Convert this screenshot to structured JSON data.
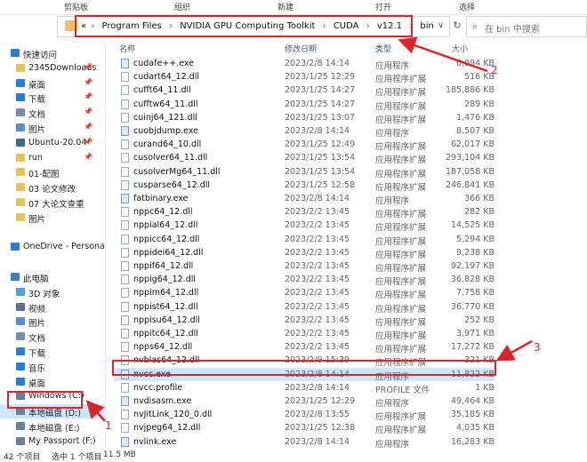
{
  "ribbon": {
    "clipboard": "剪贴板",
    "organize": "组织",
    "new": "新建",
    "open": "打开",
    "select": "选择"
  },
  "address": {
    "prefix": "«",
    "segments": [
      "Program Files",
      "NVIDIA GPU Computing Toolkit",
      "CUDA",
      "v12.1",
      "bin"
    ],
    "separator": "›",
    "dropdown": "∨"
  },
  "search": {
    "placeholder": "在 bin 中搜索"
  },
  "columns": {
    "name": "名称",
    "date": "修改日期",
    "type": "类型",
    "size": "大小"
  },
  "sidebar": [
    {
      "label": "快速访问",
      "icon": "star-icon",
      "color": "#2b7cd3",
      "indent": 0,
      "pin": ""
    },
    {
      "label": "2345Downloads",
      "icon": "folder-icon",
      "color": "#e8c25a",
      "indent": 1,
      "pin": "📌"
    },
    {
      "label": "桌面",
      "icon": "desktop-icon",
      "color": "#2b7cd3",
      "indent": 1,
      "pin": "📌"
    },
    {
      "label": "下载",
      "icon": "download-icon",
      "color": "#2b7cd3",
      "indent": 1,
      "pin": "📌"
    },
    {
      "label": "文档",
      "icon": "document-icon",
      "color": "#7a8ea6",
      "indent": 1,
      "pin": "📌"
    },
    {
      "label": "图片",
      "icon": "pictures-icon",
      "color": "#5b8fc7",
      "indent": 1,
      "pin": "📌"
    },
    {
      "label": "Ubuntu-20.04",
      "icon": "linux-icon",
      "color": "#3c6e8c",
      "indent": 1,
      "pin": "📌"
    },
    {
      "label": "run",
      "icon": "folder-icon",
      "color": "#e8c25a",
      "indent": 1,
      "pin": "📌"
    },
    {
      "label": "01-配图",
      "icon": "folder-icon",
      "color": "#e8c25a",
      "indent": 1,
      "pin": ""
    },
    {
      "label": "03 论文修改",
      "icon": "folder-icon",
      "color": "#e8c25a",
      "indent": 1,
      "pin": ""
    },
    {
      "label": "07 大论文查重",
      "icon": "folder-icon",
      "color": "#e8c25a",
      "indent": 1,
      "pin": ""
    },
    {
      "label": "图片",
      "icon": "folder-icon",
      "color": "#e8c25a",
      "indent": 1,
      "pin": ""
    },
    {
      "label": "",
      "icon": "",
      "color": "",
      "indent": 0,
      "pin": ""
    },
    {
      "label": "OneDrive - Persona",
      "icon": "cloud-icon",
      "color": "#2b7cd3",
      "indent": 0,
      "pin": ""
    },
    {
      "label": "",
      "icon": "",
      "color": "",
      "indent": 0,
      "pin": ""
    },
    {
      "label": "此电脑",
      "icon": "computer-icon",
      "color": "#3c7fc7",
      "indent": 0,
      "pin": ""
    },
    {
      "label": "3D 对象",
      "icon": "cube-icon",
      "color": "#4fa3d9",
      "indent": 1,
      "pin": ""
    },
    {
      "label": "视频",
      "icon": "video-icon",
      "color": "#5b6f8a",
      "indent": 1,
      "pin": ""
    },
    {
      "label": "图片",
      "icon": "pictures-icon",
      "color": "#5b8fc7",
      "indent": 1,
      "pin": ""
    },
    {
      "label": "文档",
      "icon": "document-icon",
      "color": "#7a8ea6",
      "indent": 1,
      "pin": ""
    },
    {
      "label": "下载",
      "icon": "download-icon",
      "color": "#2b7cd3",
      "indent": 1,
      "pin": ""
    },
    {
      "label": "音乐",
      "icon": "music-icon",
      "color": "#2b7cd3",
      "indent": 1,
      "pin": ""
    },
    {
      "label": "桌面",
      "icon": "desktop-icon",
      "color": "#2b7cd3",
      "indent": 1,
      "pin": ""
    },
    {
      "label": "Windows (C:)",
      "icon": "drive-icon",
      "color": "#6a7f95",
      "indent": 1,
      "pin": ""
    },
    {
      "label": "本地磁盘 (D:)",
      "icon": "drive-icon",
      "color": "#6a7f95",
      "indent": 1,
      "pin": "",
      "selected": true
    },
    {
      "label": "本地磁盘 (E:)",
      "icon": "drive-icon",
      "color": "#6a7f95",
      "indent": 1,
      "pin": ""
    },
    {
      "label": "My Passport (F:)",
      "icon": "drive-icon",
      "color": "#6a7f95",
      "indent": 1,
      "pin": ""
    }
  ],
  "files": [
    {
      "name": "cudafe++.exe",
      "date": "2023/2/8 14:14",
      "type": "应用程序",
      "size": "6,094 KB",
      "kind": "exe"
    },
    {
      "name": "cudart64_12.dll",
      "date": "2023/1/25 12:29",
      "type": "应用程序扩展",
      "size": "516 KB",
      "kind": "dll"
    },
    {
      "name": "cufft64_11.dll",
      "date": "2023/1/25 14:27",
      "type": "应用程序扩展",
      "size": "185,886 KB",
      "kind": "dll"
    },
    {
      "name": "cufftw64_11.dll",
      "date": "2023/1/25 14:27",
      "type": "应用程序扩展",
      "size": "289 KB",
      "kind": "dll"
    },
    {
      "name": "cuinj64_121.dll",
      "date": "2023/1/25 13:07",
      "type": "应用程序扩展",
      "size": "1,476 KB",
      "kind": "dll"
    },
    {
      "name": "cuobjdump.exe",
      "date": "2023/2/8 14:14",
      "type": "应用程序",
      "size": "8,507 KB",
      "kind": "exe"
    },
    {
      "name": "curand64_10.dll",
      "date": "2023/1/25 12:49",
      "type": "应用程序扩展",
      "size": "62,017 KB",
      "kind": "dll"
    },
    {
      "name": "cusolver64_11.dll",
      "date": "2023/1/25 13:54",
      "type": "应用程序扩展",
      "size": "293,104 KB",
      "kind": "dll"
    },
    {
      "name": "cusolverMg64_11.dll",
      "date": "2023/1/25 13:54",
      "type": "应用程序扩展",
      "size": "187,058 KB",
      "kind": "dll"
    },
    {
      "name": "cusparse64_12.dll",
      "date": "2023/1/25 12:58",
      "type": "应用程序扩展",
      "size": "246,841 KB",
      "kind": "dll"
    },
    {
      "name": "fatbinary.exe",
      "date": "2023/2/8 14:14",
      "type": "应用程序",
      "size": "366 KB",
      "kind": "exe"
    },
    {
      "name": "nppc64_12.dll",
      "date": "2023/2/2 13:45",
      "type": "应用程序扩展",
      "size": "282 KB",
      "kind": "dll"
    },
    {
      "name": "nppial64_12.dll",
      "date": "2023/2/2 13:45",
      "type": "应用程序扩展",
      "size": "14,525 KB",
      "kind": "dll"
    },
    {
      "name": "nppicc64_12.dll",
      "date": "2023/2/2 13:45",
      "type": "应用程序扩展",
      "size": "5,294 KB",
      "kind": "dll"
    },
    {
      "name": "nppidei64_12.dll",
      "date": "2023/2/2 13:45",
      "type": "应用程序扩展",
      "size": "9,238 KB",
      "kind": "dll"
    },
    {
      "name": "nppif64_12.dll",
      "date": "2023/2/2 13:45",
      "type": "应用程序扩展",
      "size": "92,197 KB",
      "kind": "dll"
    },
    {
      "name": "nppig64_12.dll",
      "date": "2023/2/2 13:45",
      "type": "应用程序扩展",
      "size": "36,828 KB",
      "kind": "dll"
    },
    {
      "name": "nppim64_12.dll",
      "date": "2023/2/2 13:45",
      "type": "应用程序扩展",
      "size": "7,758 KB",
      "kind": "dll"
    },
    {
      "name": "nppist64_12.dll",
      "date": "2023/2/2 13:45",
      "type": "应用程序扩展",
      "size": "36,770 KB",
      "kind": "dll"
    },
    {
      "name": "nppisu64_12.dll",
      "date": "2023/2/2 13:45",
      "type": "应用程序扩展",
      "size": "252 KB",
      "kind": "dll"
    },
    {
      "name": "nppitc64_12.dll",
      "date": "2023/2/2 13:45",
      "type": "应用程序扩展",
      "size": "3,971 KB",
      "kind": "dll"
    },
    {
      "name": "npps64_12.dll",
      "date": "2023/2/2 13:45",
      "type": "应用程序扩展",
      "size": "17,272 KB",
      "kind": "dll"
    },
    {
      "name": "nvblas64_12.dll",
      "date": "2023/2/9 15:39",
      "type": "应用程序扩展",
      "size": "321 KB",
      "kind": "dll"
    },
    {
      "name": "nvcc.exe",
      "date": "2023/2/8 14:14",
      "type": "应用程序",
      "size": "11,822 KB",
      "kind": "exe",
      "selected": true
    },
    {
      "name": "nvcc.profile",
      "date": "2023/2/8 14:14",
      "type": "PROFILE 文件",
      "size": "1 KB",
      "kind": "file"
    },
    {
      "name": "nvdisasm.exe",
      "date": "2023/1/25 12:29",
      "type": "应用程序",
      "size": "49,464 KB",
      "kind": "exe"
    },
    {
      "name": "nvJitLink_120_0.dll",
      "date": "2023/2/8 13:55",
      "type": "应用程序扩展",
      "size": "35,185 KB",
      "kind": "dll"
    },
    {
      "name": "nvjpeg64_12.dll",
      "date": "2023/1/25 12:38",
      "type": "应用程序扩展",
      "size": "4,035 KB",
      "kind": "dll"
    },
    {
      "name": "nvlink.exe",
      "date": "2023/2/8 14:14",
      "type": "应用程序",
      "size": "16,283 KB",
      "kind": "exe"
    }
  ],
  "status": {
    "count": "42 个项目",
    "selected": "选中 1 个项目",
    "size": "11.5 MB"
  },
  "annotations": {
    "one": "1",
    "two": "2",
    "three": "3",
    "color": "#d9262c"
  },
  "colors": {
    "selection": "#cce8ff",
    "accent": "#2b7cd3"
  }
}
